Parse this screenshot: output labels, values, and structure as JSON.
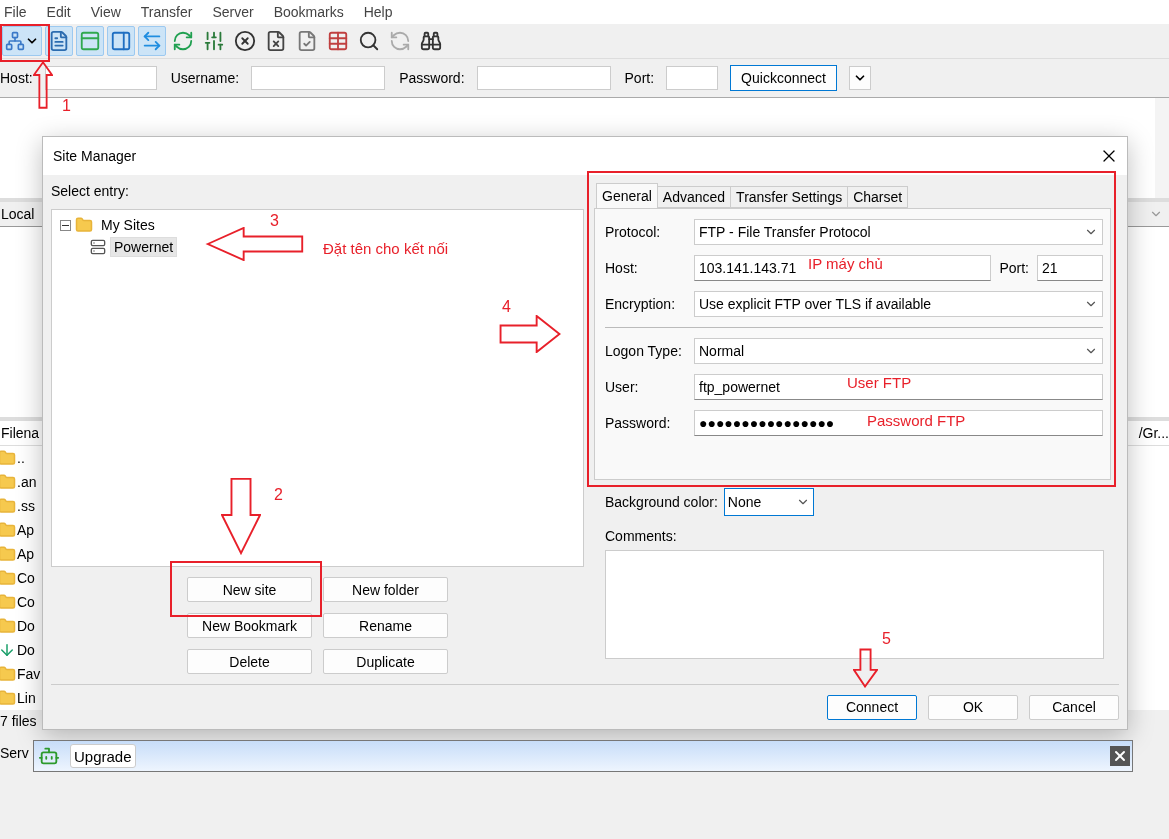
{
  "menu": [
    "File",
    "Edit",
    "View",
    "Transfer",
    "Server",
    "Bookmarks",
    "Help"
  ],
  "toolbar": {
    "toggles": [
      {
        "on": true
      },
      {
        "on": true
      },
      {
        "on": true
      },
      {
        "on": true
      }
    ]
  },
  "quickconnect": {
    "fields": [
      {
        "label": "Host:"
      },
      {
        "label": "Username:"
      },
      {
        "label": "Password:"
      },
      {
        "label": "Port:"
      }
    ],
    "button": "Quickconnect"
  },
  "local_site": {
    "label": "Local",
    "filename_header": "Filena",
    "column_fragment": "/Gr..."
  },
  "files": [
    {
      "name": "..",
      "kind": "folder"
    },
    {
      "name": ".an",
      "kind": "folder"
    },
    {
      "name": ".ss",
      "kind": "folder"
    },
    {
      "name": "Ap",
      "kind": "folder"
    },
    {
      "name": "Ap",
      "kind": "folder"
    },
    {
      "name": "Co",
      "kind": "folder"
    },
    {
      "name": "Co",
      "kind": "folder"
    },
    {
      "name": "Do",
      "kind": "folder"
    },
    {
      "name": "Do",
      "kind": "download"
    },
    {
      "name": "Fav",
      "kind": "folder"
    },
    {
      "name": "Lin",
      "kind": "folder"
    }
  ],
  "status_text": "7 files",
  "log_tab": "Serv",
  "dialog": {
    "title": "Site Manager",
    "select_entry": "Select entry:",
    "tree": [
      {
        "label": "My Sites",
        "expanded": true,
        "selected": false,
        "children": [
          {
            "label": "Powernet",
            "selected": true
          }
        ]
      }
    ],
    "buttons": [
      "New site",
      "New folder",
      "New Bookmark",
      "Rename",
      "Delete",
      "Duplicate"
    ],
    "tabs": [
      {
        "label": "General",
        "selected": true
      },
      {
        "label": "Advanced",
        "selected": false
      },
      {
        "label": "Transfer Settings",
        "selected": false
      },
      {
        "label": "Charset",
        "selected": false
      }
    ],
    "fields": [
      {
        "kind": "select",
        "label": "Protocol:",
        "value": "FTP - File Transfer Protocol"
      },
      {
        "kind": "host",
        "label": "Host:",
        "value": "103.141.143.71",
        "port_label": "Port:",
        "port": "21"
      },
      {
        "kind": "select",
        "label": "Encryption:",
        "value": "Use explicit FTP over TLS if available"
      },
      {
        "kind": "separator"
      },
      {
        "kind": "select",
        "label": "Logon Type:",
        "value": "Normal"
      },
      {
        "kind": "text",
        "label": "User:",
        "value": "ftp_powernet"
      },
      {
        "kind": "text",
        "label": "Password:",
        "value": "●●●●●●●●●●●●●●●●"
      }
    ],
    "background_color": {
      "label": "Background color:",
      "value": "None"
    },
    "comments": {
      "label": "Comments:"
    },
    "footer": [
      {
        "label": "Connect",
        "default": true
      },
      {
        "label": "OK",
        "default": false
      },
      {
        "label": "Cancel",
        "default": false
      }
    ]
  },
  "upgrade_bar": {
    "button": "Upgrade"
  },
  "annotations": [
    {
      "kind": "number",
      "text": "1"
    },
    {
      "kind": "number",
      "text": "2"
    },
    {
      "kind": "number",
      "text": "3"
    },
    {
      "kind": "number",
      "text": "4"
    },
    {
      "kind": "number",
      "text": "5"
    },
    {
      "kind": "note",
      "text": "Đặt tên cho kết nối"
    },
    {
      "kind": "note",
      "text": "IP máy chủ"
    },
    {
      "kind": "note",
      "text": "User FTP"
    },
    {
      "kind": "note",
      "text": "Password FTP"
    }
  ]
}
